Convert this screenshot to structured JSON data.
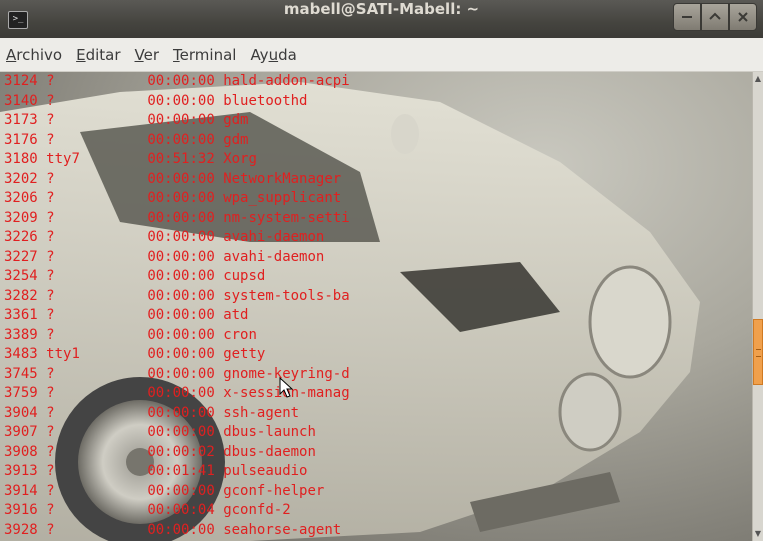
{
  "window": {
    "title": "mabell@SATI-Mabell: ~",
    "app_icon": "terminal-icon",
    "buttons": [
      "minimize-icon",
      "maximize-icon",
      "close-icon"
    ]
  },
  "menu": [
    {
      "pre": "",
      "ul": "A",
      "post": "rchivo"
    },
    {
      "pre": "",
      "ul": "E",
      "post": "ditar"
    },
    {
      "pre": "",
      "ul": "V",
      "post": "er"
    },
    {
      "pre": "",
      "ul": "T",
      "post": "erminal"
    },
    {
      "pre": "Ay",
      "ul": "u",
      "post": "da"
    }
  ],
  "terminal": {
    "text_color": "#e02020",
    "processes": [
      {
        "pid": "3124",
        "tty": "?",
        "time": "00:00:00",
        "cmd": "hald-addon-acpi"
      },
      {
        "pid": "3140",
        "tty": "?",
        "time": "00:00:00",
        "cmd": "bluetoothd"
      },
      {
        "pid": "3173",
        "tty": "?",
        "time": "00:00:00",
        "cmd": "gdm"
      },
      {
        "pid": "3176",
        "tty": "?",
        "time": "00:00:00",
        "cmd": "gdm"
      },
      {
        "pid": "3180",
        "tty": "tty7",
        "time": "00:51:32",
        "cmd": "Xorg"
      },
      {
        "pid": "3202",
        "tty": "?",
        "time": "00:00:00",
        "cmd": "NetworkManager"
      },
      {
        "pid": "3206",
        "tty": "?",
        "time": "00:00:00",
        "cmd": "wpa_supplicant"
      },
      {
        "pid": "3209",
        "tty": "?",
        "time": "00:00:00",
        "cmd": "nm-system-setti"
      },
      {
        "pid": "3226",
        "tty": "?",
        "time": "00:00:00",
        "cmd": "avahi-daemon"
      },
      {
        "pid": "3227",
        "tty": "?",
        "time": "00:00:00",
        "cmd": "avahi-daemon"
      },
      {
        "pid": "3254",
        "tty": "?",
        "time": "00:00:00",
        "cmd": "cupsd"
      },
      {
        "pid": "3282",
        "tty": "?",
        "time": "00:00:00",
        "cmd": "system-tools-ba"
      },
      {
        "pid": "3361",
        "tty": "?",
        "time": "00:00:00",
        "cmd": "atd"
      },
      {
        "pid": "3389",
        "tty": "?",
        "time": "00:00:00",
        "cmd": "cron"
      },
      {
        "pid": "3483",
        "tty": "tty1",
        "time": "00:00:00",
        "cmd": "getty"
      },
      {
        "pid": "3745",
        "tty": "?",
        "time": "00:00:00",
        "cmd": "gnome-keyring-d"
      },
      {
        "pid": "3759",
        "tty": "?",
        "time": "00:00:00",
        "cmd": "x-session-manag"
      },
      {
        "pid": "3904",
        "tty": "?",
        "time": "00:00:00",
        "cmd": "ssh-agent"
      },
      {
        "pid": "3907",
        "tty": "?",
        "time": "00:00:00",
        "cmd": "dbus-launch"
      },
      {
        "pid": "3908",
        "tty": "?",
        "time": "00:00:02",
        "cmd": "dbus-daemon"
      },
      {
        "pid": "3913",
        "tty": "?",
        "time": "00:01:41",
        "cmd": "pulseaudio"
      },
      {
        "pid": "3914",
        "tty": "?",
        "time": "00:00:00",
        "cmd": "gconf-helper"
      },
      {
        "pid": "3916",
        "tty": "?",
        "time": "00:00:04",
        "cmd": "gconfd-2"
      },
      {
        "pid": "3928",
        "tty": "?",
        "time": "00:00:00",
        "cmd": "seahorse-agent"
      }
    ]
  },
  "scrollbar": {
    "thumb_color": "#f0a04c"
  }
}
